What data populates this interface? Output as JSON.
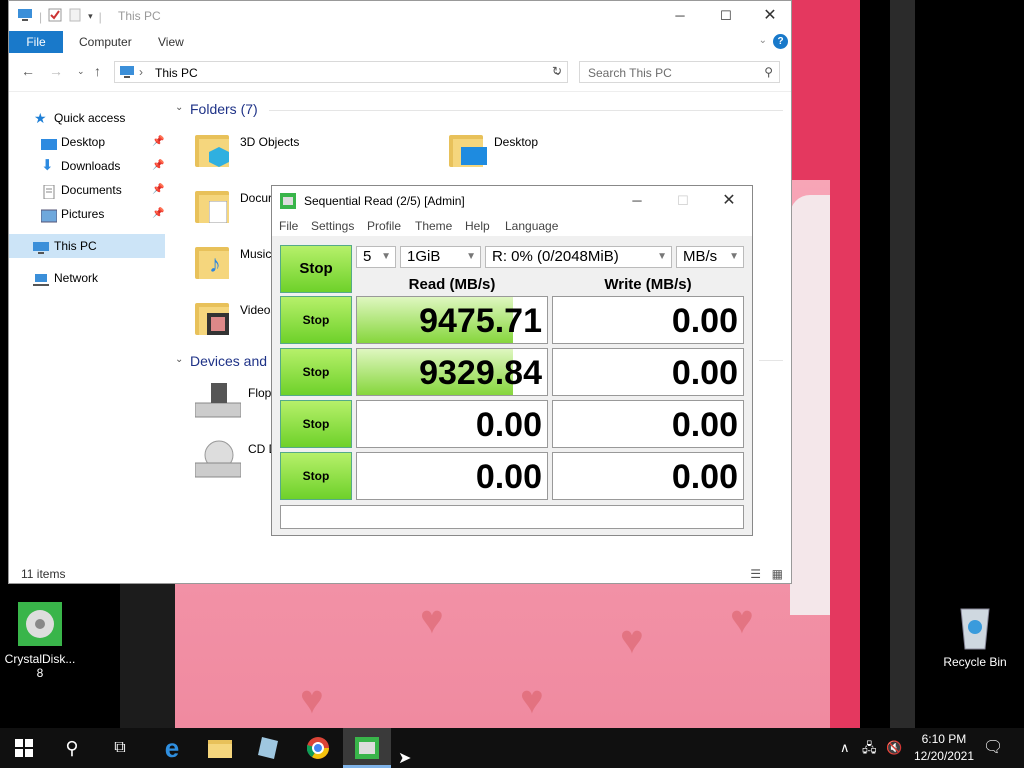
{
  "explorer": {
    "title": "This PC",
    "ribbon_tabs": [
      "File",
      "Computer",
      "View"
    ],
    "help_glyph": "?",
    "address": "This PC",
    "search_placeholder": "Search This PC",
    "nav": [
      {
        "label": "Quick access",
        "icon": "star-icon"
      },
      {
        "label": "Desktop",
        "icon": "desktop-icon",
        "pinned": true
      },
      {
        "label": "Downloads",
        "icon": "download-icon",
        "pinned": true
      },
      {
        "label": "Documents",
        "icon": "documents-icon",
        "pinned": true
      },
      {
        "label": "Pictures",
        "icon": "pictures-icon",
        "pinned": true
      },
      {
        "label": "This PC",
        "icon": "computer-icon",
        "selected": true
      },
      {
        "label": "Network",
        "icon": "network-icon"
      }
    ],
    "folders_header": "Folders (7)",
    "folders": [
      "3D Objects",
      "Desktop",
      "Docur",
      "Music",
      "Videos"
    ],
    "devices_header": "Devices and",
    "devices": [
      "Floppy",
      "CD Dri"
    ],
    "status": "11 items"
  },
  "cdm": {
    "title": "Sequential Read (2/5) [Admin]",
    "menu": [
      "File",
      "Settings",
      "Profile",
      "Theme",
      "Help",
      "Language"
    ],
    "main_button": "Stop",
    "count": "5",
    "size": "1GiB",
    "drive": "R: 0% (0/2048MiB)",
    "unit": "MB/s",
    "read_header": "Read (MB/s)",
    "write_header": "Write (MB/s)",
    "rows": [
      {
        "button": "Stop",
        "read": "9475.71",
        "write": "0.00",
        "fill": 0.82
      },
      {
        "button": "Stop",
        "read": "9329.84",
        "write": "0.00",
        "fill": 0.82
      },
      {
        "button": "Stop",
        "read": "0.00",
        "write": "0.00",
        "fill": 0
      },
      {
        "button": "Stop",
        "read": "0.00",
        "write": "0.00",
        "fill": 0
      }
    ]
  },
  "desktop": {
    "crystal_label_1": "CrystalDisk...",
    "crystal_label_2": "8",
    "recycle_label": "Recycle Bin"
  },
  "taskbar": {
    "time": "6:10 PM",
    "date": "12/20/2021"
  }
}
